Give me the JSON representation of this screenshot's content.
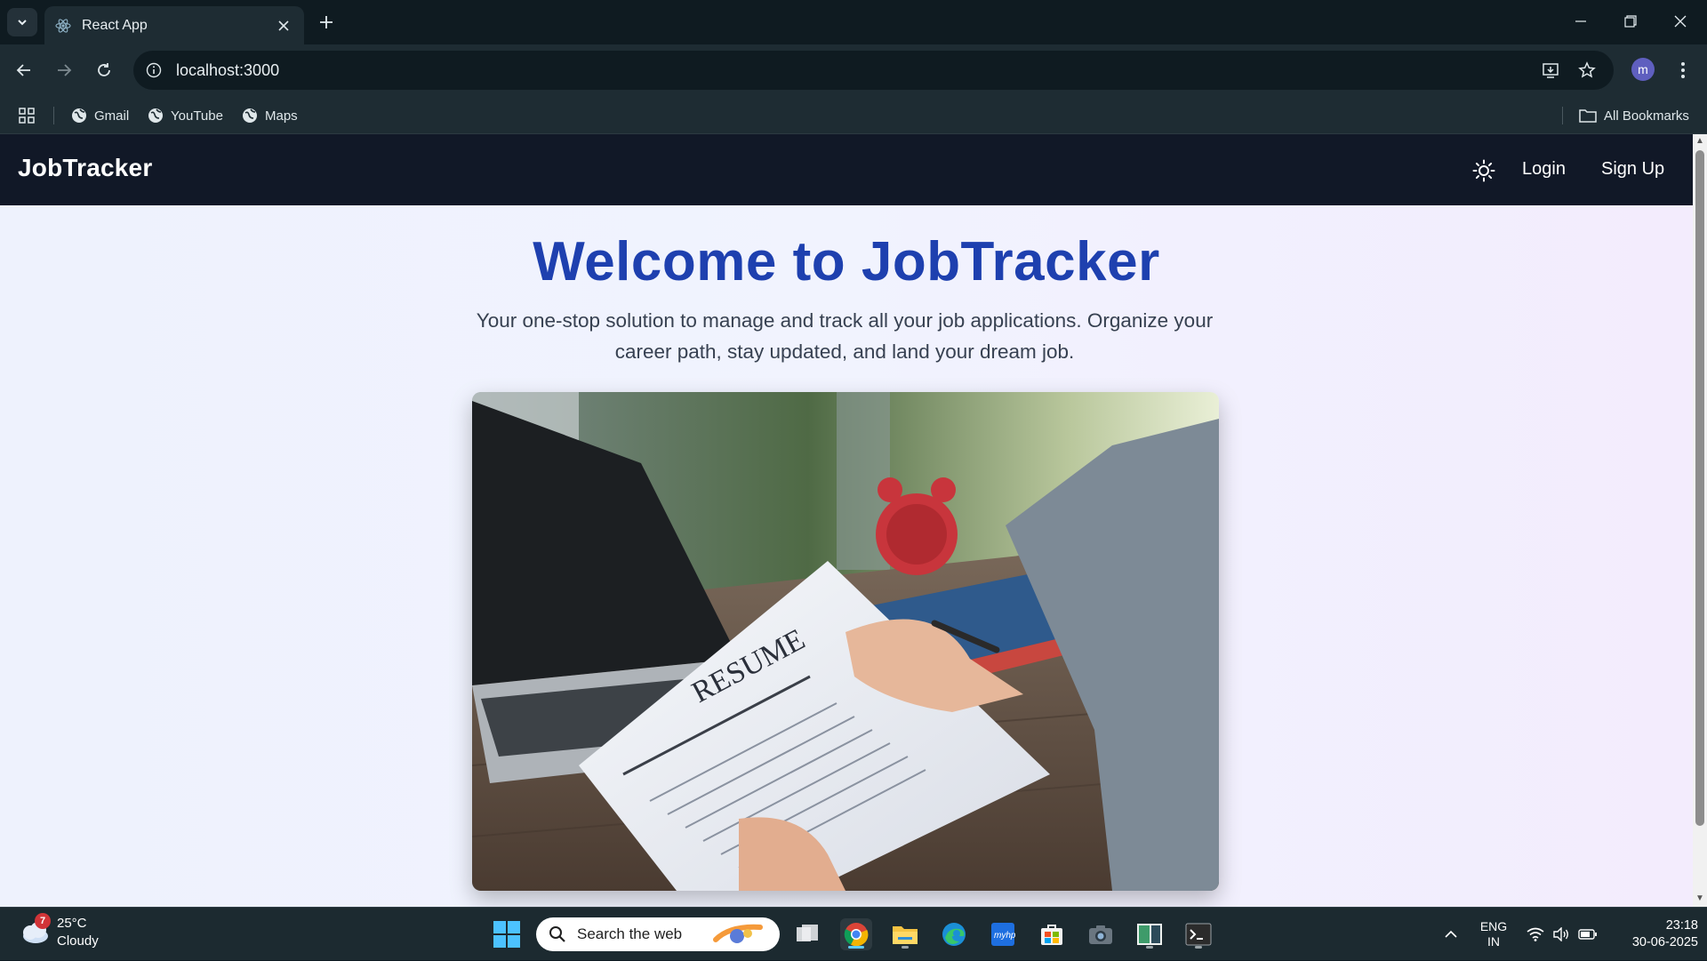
{
  "browser": {
    "tab_title": "React App",
    "url": "localhost:3000",
    "profile_initial": "m",
    "bookmarks": [
      {
        "label": "Gmail"
      },
      {
        "label": "YouTube"
      },
      {
        "label": "Maps"
      }
    ],
    "all_bookmarks_label": "All Bookmarks"
  },
  "app": {
    "brand": "JobTracker",
    "nav": {
      "login": "Login",
      "signup": "Sign Up"
    },
    "hero": {
      "title": "Welcome to JobTracker",
      "subtitle": "Your one-stop solution to manage and track all your job applications. Organize your career path, stay updated, and land your dream job.",
      "image_text": "RESUME"
    }
  },
  "taskbar": {
    "weather_temp": "25°C",
    "weather_desc": "Cloudy",
    "weather_badge": "7",
    "search_placeholder": "Search the web",
    "lang_top": "ENG",
    "lang_bottom": "IN",
    "time": "23:18",
    "date": "30-06-2025"
  },
  "colors": {
    "nav_bg": "#111827",
    "hero_title": "#1e40af",
    "subtitle": "#374151",
    "chrome_bg": "#1e2c33"
  }
}
